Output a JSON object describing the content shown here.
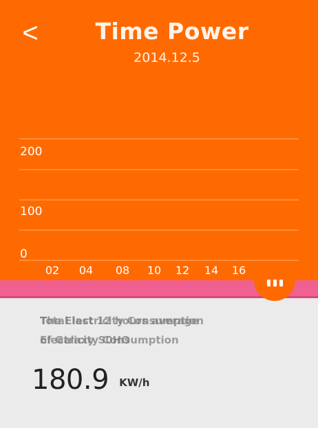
{
  "header": {
    "back_label": "<",
    "title": "Time Power",
    "date": "2014.12.5"
  },
  "chart_data": {
    "type": "line",
    "title": "",
    "xlabel": "",
    "ylabel": "",
    "x_ticks": [
      "02",
      "04",
      "08",
      "10",
      "12",
      "14",
      "16"
    ],
    "y_ticks": [
      "200",
      "100",
      "0"
    ],
    "ylim": [
      0,
      200
    ],
    "grid": true,
    "series": []
  },
  "summary": {
    "overlay_texts": [
      "The Electricity Consumption",
      "Total last 12 hours average",
      "of Galaxy S0HO",
      "Electricity Consumption"
    ],
    "value": "180.9",
    "unit": "KW/h"
  },
  "colors": {
    "header_bg": "#ff6a00",
    "accent_pink": "#f06090",
    "page_bg": "#ebebeb"
  },
  "icons": {
    "back": "chevron-left-icon",
    "more": "more-icon"
  }
}
